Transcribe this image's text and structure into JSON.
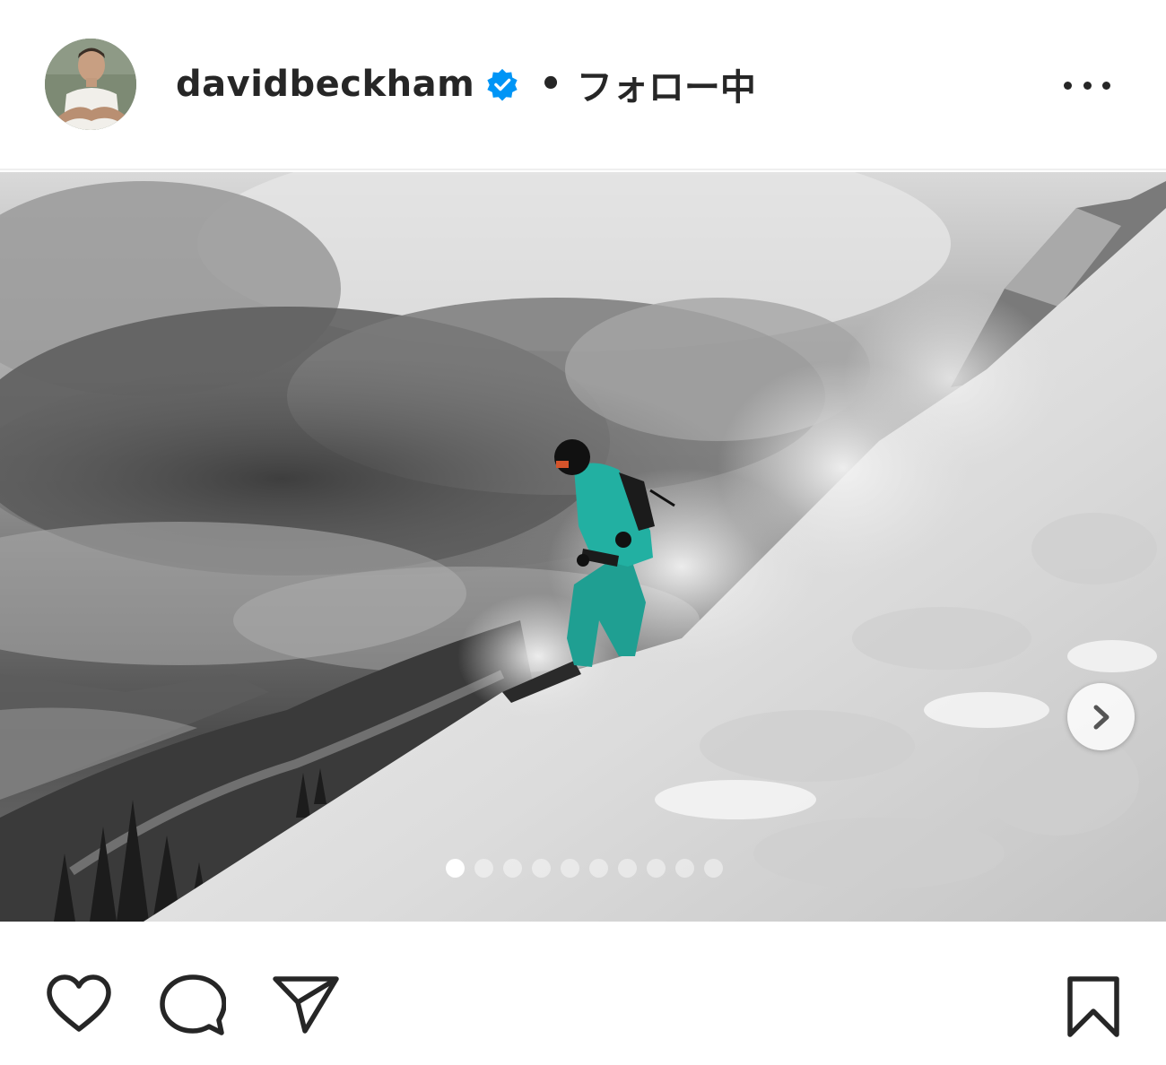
{
  "post": {
    "username": "davidbeckham",
    "separator": "•",
    "follow_status": "フォロー中",
    "verified": true
  },
  "carousel": {
    "total_slides": 10,
    "active_index": 0
  },
  "icons": {
    "avatar": "avatar",
    "verified": "verified-badge-icon",
    "more": "more-options-icon",
    "next": "chevron-right-icon",
    "like": "heart-icon",
    "comment": "comment-icon",
    "share": "paper-plane-icon",
    "save": "bookmark-icon"
  },
  "colors": {
    "text": "#262626",
    "verified": "#0095f6",
    "jacket": "#1fa89a"
  }
}
